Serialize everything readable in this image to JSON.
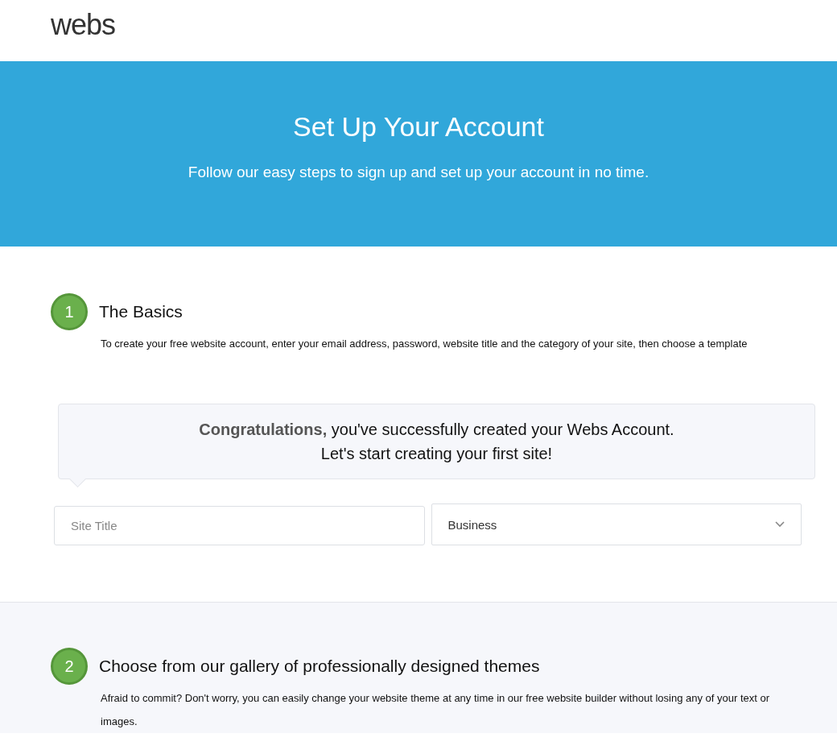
{
  "header": {
    "logo": "webs"
  },
  "hero": {
    "title": "Set Up Your Account",
    "subtitle": "Follow our easy steps to sign up and set up your account in no time."
  },
  "steps": [
    {
      "number": "1",
      "title": "The Basics",
      "description": "To create your free website account, enter your email address, password, website title and the category of your site, then choose a template",
      "callout": {
        "lines": [
          "**Congratulations,** you've successfully created your Webs Account.",
          "Let's start creating your first site!"
        ]
      },
      "form": {
        "site_title": {
          "placeholder": "Site Title"
        },
        "category": {
          "value": "Business"
        }
      }
    },
    {
      "number": "2",
      "title": "Choose from our gallery of professionally designed themes",
      "description": "Afraid to commit? Don't worry, you can easily change your website theme at any time in our free website builder without losing any of your text or images."
    }
  ]
}
